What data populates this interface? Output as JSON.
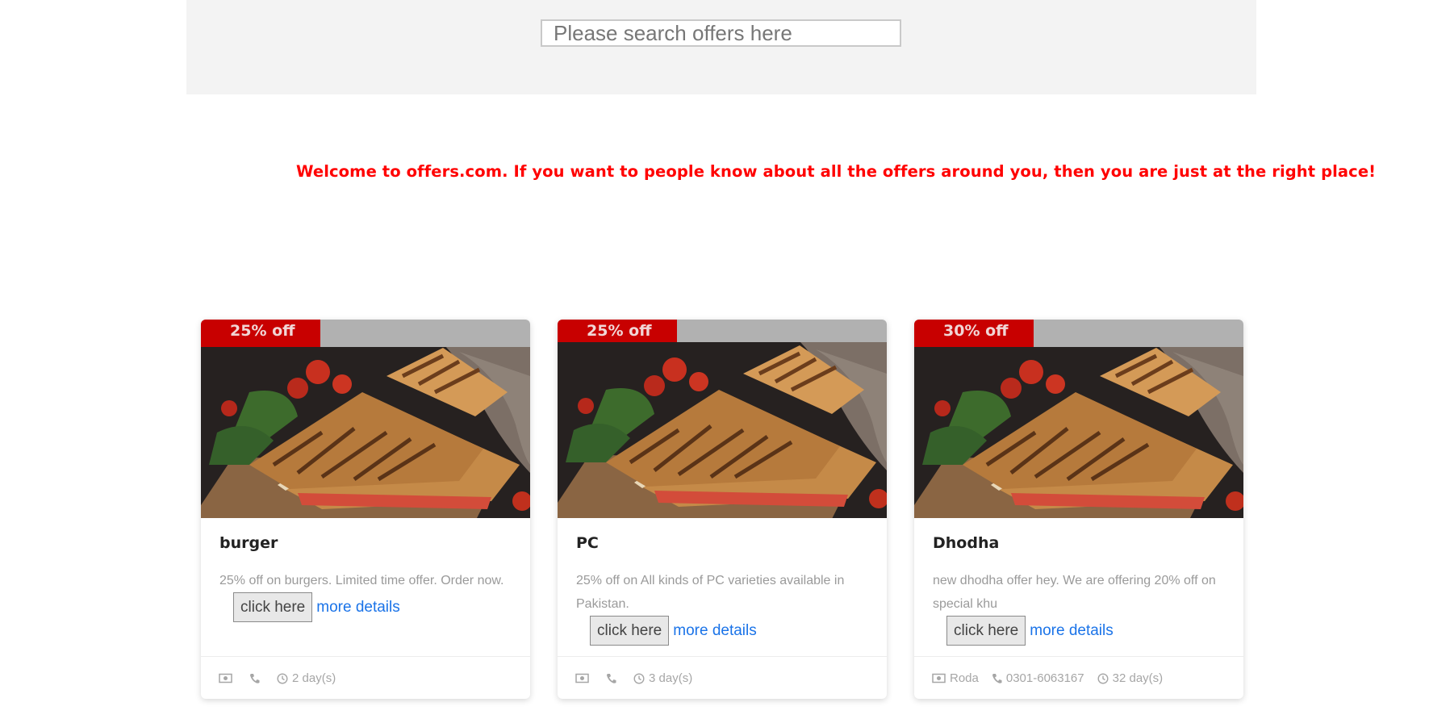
{
  "search": {
    "placeholder": "Please search offers here"
  },
  "welcome_text": "Welcome to offers.com. If you want to people know about all the offers around you, then you are just at the right place!",
  "cards": [
    {
      "discount": "25% off",
      "title": "burger",
      "description": "25% off on burgers. Limited time offer. Order now.",
      "button_label": "click here",
      "link_label": "more details",
      "footer": {
        "location": "",
        "phone": "",
        "duration": "2 day(s)"
      }
    },
    {
      "discount": "25% off",
      "title": "PC",
      "description": "25% off on All kinds of PC varieties available in Pakistan.",
      "button_label": "click here",
      "link_label": "more details",
      "footer": {
        "location": "",
        "phone": "",
        "duration": "3 day(s)"
      }
    },
    {
      "discount": "30% off",
      "title": "Dhodha",
      "description": "new dhodha offer hey. We are offering 20% off on special khu",
      "button_label": "click here",
      "link_label": "more details",
      "footer": {
        "location": "Roda",
        "phone": "0301-6063167",
        "duration": "32 day(s)"
      }
    }
  ],
  "colors": {
    "accent_red": "#ff0000",
    "badge_red": "#c80000",
    "link_blue": "#1a73e8"
  },
  "icons": [
    "money-icon",
    "phone-icon",
    "clock-icon"
  ]
}
